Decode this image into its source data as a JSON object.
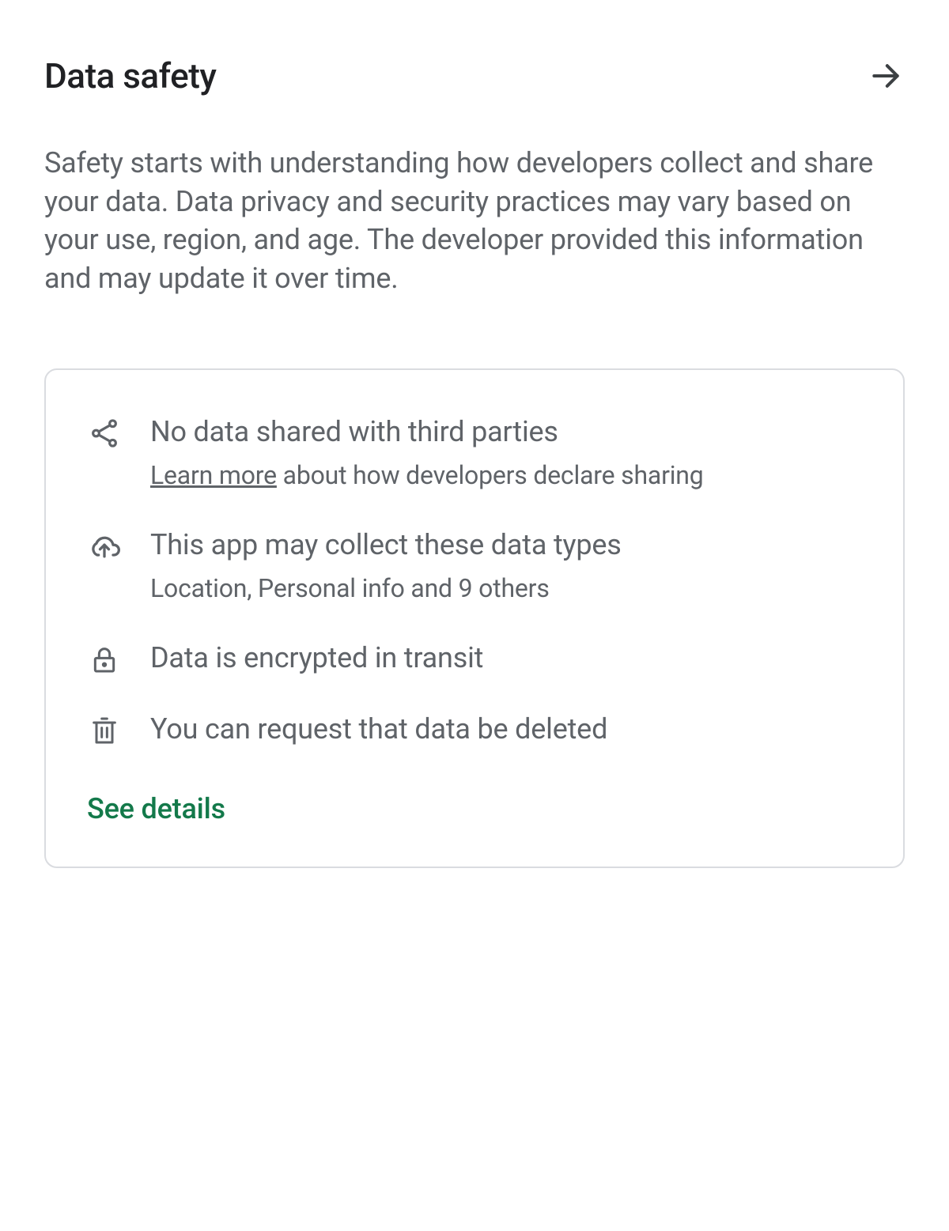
{
  "header": {
    "title": "Data safety"
  },
  "description": "Safety starts with understanding how developers collect and share your data. Data privacy and security practices may vary based on your use, region, and age. The developer provided this information and may update it over time.",
  "card": {
    "items": [
      {
        "icon": "share-icon",
        "title": "No data shared with third parties",
        "learn_more_text": "Learn more",
        "sub_remainder": " about how developers declare sharing"
      },
      {
        "icon": "cloud-upload-icon",
        "title": "This app may collect these data types",
        "sub": "Location, Personal info and 9 others"
      },
      {
        "icon": "lock-icon",
        "title": "Data is encrypted in transit"
      },
      {
        "icon": "delete-icon",
        "title": "You can request that data be deleted"
      }
    ],
    "see_details": "See details"
  }
}
